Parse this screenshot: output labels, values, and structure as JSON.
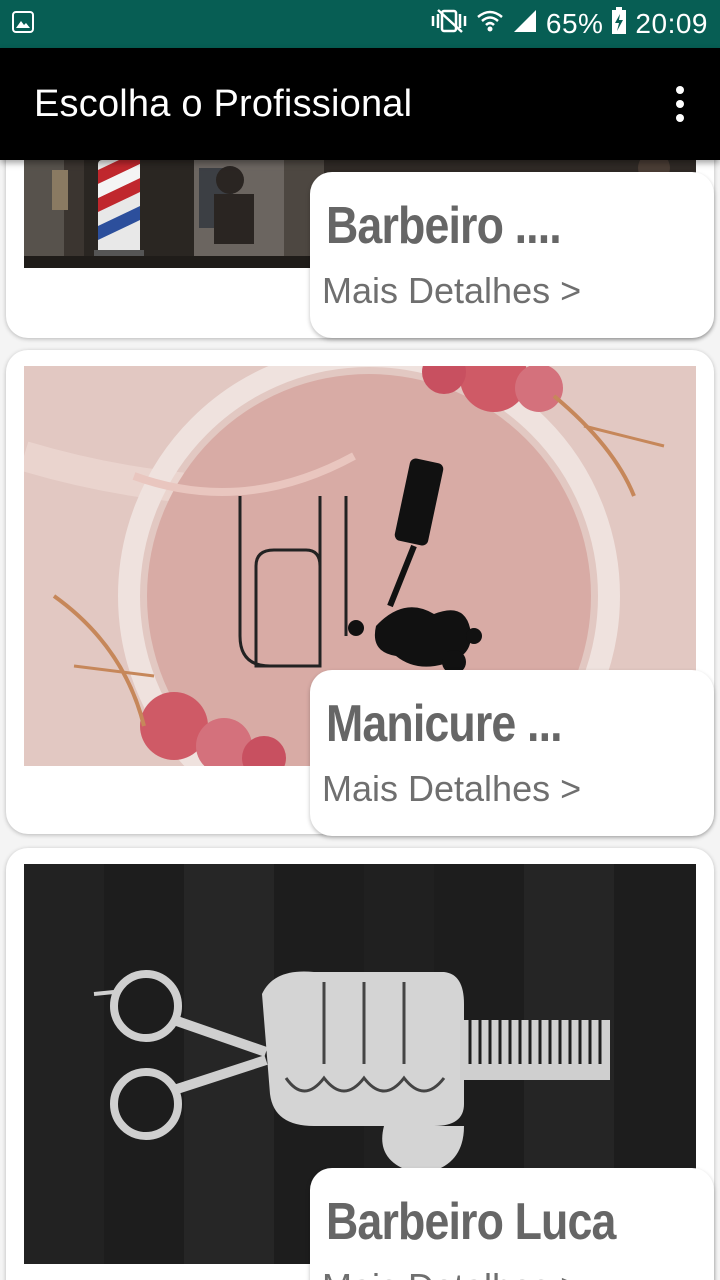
{
  "status_bar": {
    "battery_percent": "65%",
    "time": "20:09",
    "icons": [
      "image-icon",
      "mute-vibrate-icon",
      "wifi-icon",
      "signal-icon",
      "battery-charging-icon"
    ],
    "background": "#075e54"
  },
  "app_bar": {
    "title": "Escolha o Profissional",
    "background": "#000000",
    "menu_icon": "overflow-menu-icon"
  },
  "professionals": [
    {
      "name": "Barbeiro ....",
      "details_label": "Mais Detalhes >"
    },
    {
      "name": "Manicure ...",
      "details_label": "Mais Detalhes >"
    },
    {
      "name": "Barbeiro Luca",
      "details_label": "Mais Detalhes >"
    }
  ]
}
